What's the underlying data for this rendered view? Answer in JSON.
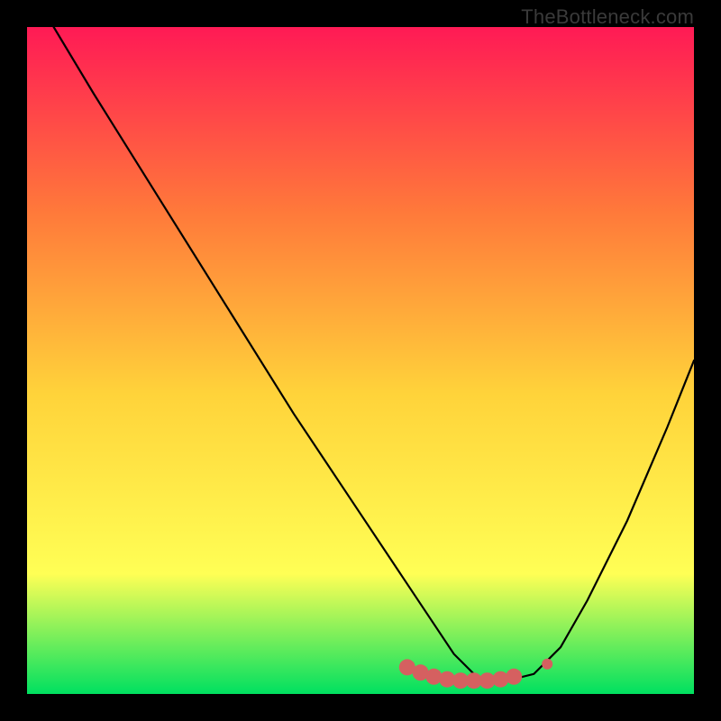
{
  "watermark": "TheBottleneck.com",
  "colors": {
    "gradient_top": "#ff1a55",
    "gradient_mid_upper": "#ff7a3a",
    "gradient_mid": "#ffd33a",
    "gradient_mid_lower": "#ffff55",
    "gradient_bottom": "#00e060",
    "curve": "#000000",
    "marker_fill": "#d56060",
    "marker_stroke": "#c44545",
    "frame": "#000000"
  },
  "chart_data": {
    "type": "line",
    "title": "",
    "xlabel": "",
    "ylabel": "",
    "xlim": [
      0,
      100
    ],
    "ylim": [
      0,
      100
    ],
    "grid": false,
    "curve": {
      "description": "V-shaped bottleneck curve; high on both extremes, minimum near x≈68",
      "x": [
        4,
        10,
        20,
        30,
        40,
        50,
        56,
        60,
        64,
        68,
        72,
        76,
        80,
        84,
        90,
        96,
        100
      ],
      "y": [
        100,
        90,
        74,
        58,
        42,
        27,
        18,
        12,
        6,
        2,
        2,
        3,
        7,
        14,
        26,
        40,
        50
      ]
    },
    "markers": {
      "description": "recommended-range markers along bottom of curve",
      "points": [
        {
          "x": 57,
          "y": 4.0
        },
        {
          "x": 59,
          "y": 3.2
        },
        {
          "x": 61,
          "y": 2.6
        },
        {
          "x": 63,
          "y": 2.2
        },
        {
          "x": 65,
          "y": 2.0
        },
        {
          "x": 67,
          "y": 2.0
        },
        {
          "x": 69,
          "y": 2.0
        },
        {
          "x": 71,
          "y": 2.2
        },
        {
          "x": 73,
          "y": 2.6
        },
        {
          "x": 78,
          "y": 4.5
        }
      ]
    }
  }
}
